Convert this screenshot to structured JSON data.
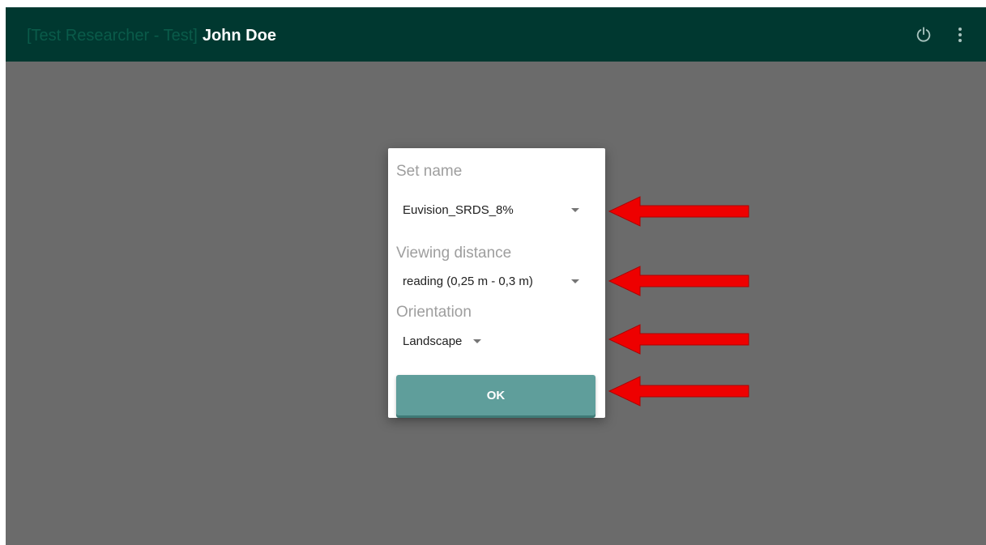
{
  "appbar": {
    "title_prefix": "[Test Researcher  - Test]",
    "title_name": "John Doe",
    "icons": [
      "power-icon",
      "more-vert-icon"
    ],
    "background_color": "#003830"
  },
  "dialog": {
    "set_name": {
      "label": "Set name",
      "value": "Euvision_SRDS_8%"
    },
    "viewing_distance": {
      "label": "Viewing distance",
      "value": "reading (0,25 m - 0,3 m)"
    },
    "orientation": {
      "label": "Orientation",
      "value": "Landscape"
    },
    "ok_label": "OK",
    "button_color": "#5f9e9b"
  },
  "annotations": {
    "arrow_color": "#ee0000",
    "arrow_count": 4
  }
}
